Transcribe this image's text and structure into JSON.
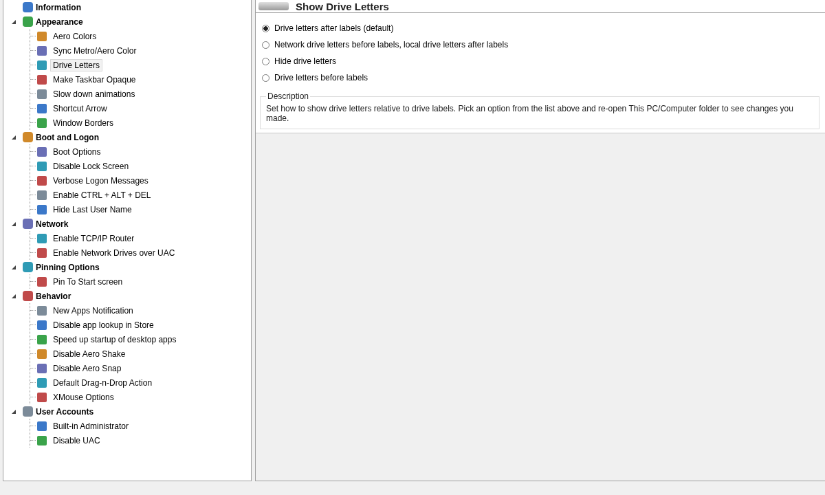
{
  "tree": {
    "items": [
      {
        "label": "Information"
      },
      {
        "label": "Appearance",
        "expanded": true,
        "children": [
          {
            "label": "Aero Colors",
            "selected": false
          },
          {
            "label": "Sync Metro/Aero Color",
            "selected": false
          },
          {
            "label": "Drive Letters",
            "selected": true
          },
          {
            "label": "Make Taskbar Opaque",
            "selected": false
          },
          {
            "label": "Slow down animations",
            "selected": false
          },
          {
            "label": "Shortcut Arrow",
            "selected": false
          },
          {
            "label": "Window Borders",
            "selected": false
          }
        ]
      },
      {
        "label": "Boot and Logon",
        "expanded": true,
        "children": [
          {
            "label": "Boot Options",
            "selected": false
          },
          {
            "label": "Disable Lock Screen",
            "selected": false
          },
          {
            "label": "Verbose Logon Messages",
            "selected": false
          },
          {
            "label": "Enable CTRL + ALT + DEL",
            "selected": false
          },
          {
            "label": "Hide Last User Name",
            "selected": false
          }
        ]
      },
      {
        "label": "Network",
        "expanded": true,
        "children": [
          {
            "label": "Enable TCP/IP Router",
            "selected": false
          },
          {
            "label": "Enable Network Drives over UAC",
            "selected": false
          }
        ]
      },
      {
        "label": "Pinning Options",
        "expanded": true,
        "children": [
          {
            "label": "Pin To Start screen",
            "selected": false
          }
        ]
      },
      {
        "label": "Behavior",
        "expanded": true,
        "children": [
          {
            "label": "New Apps Notification",
            "selected": false
          },
          {
            "label": "Disable app lookup in Store",
            "selected": false
          },
          {
            "label": "Speed up startup of desktop apps",
            "selected": false
          },
          {
            "label": "Disable Aero Shake",
            "selected": false
          },
          {
            "label": "Disable Aero Snap",
            "selected": false
          },
          {
            "label": "Default Drag-n-Drop Action",
            "selected": false
          },
          {
            "label": "XMouse Options",
            "selected": false
          }
        ]
      },
      {
        "label": "User Accounts",
        "expanded": true,
        "children": [
          {
            "label": "Built-in Administrator",
            "selected": false
          },
          {
            "label": "Disable UAC",
            "selected": false
          }
        ]
      }
    ]
  },
  "panel": {
    "title": "Show Drive Letters",
    "options": [
      {
        "label": "Drive letters after labels (default)",
        "selected": true
      },
      {
        "label": "Network drive letters before labels, local drive letters after labels",
        "selected": false
      },
      {
        "label": "Hide drive letters",
        "selected": false
      },
      {
        "label": "Drive letters before labels",
        "selected": false
      }
    ],
    "description": {
      "legend": "Description",
      "text": "Set how to show drive letters relative to drive labels. Pick an option from the list above and re-open This PC/Computer folder to see changes you made."
    }
  }
}
